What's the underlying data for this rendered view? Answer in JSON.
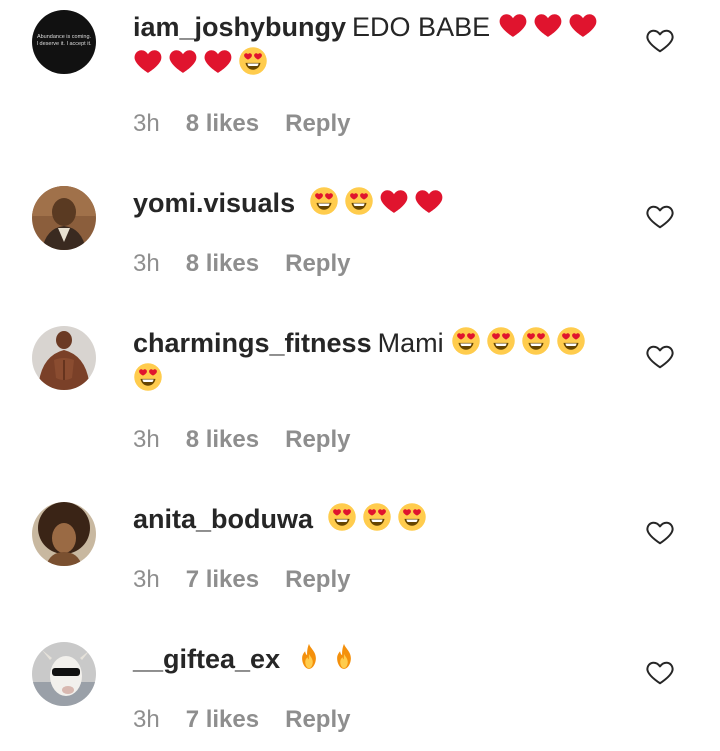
{
  "comments": [
    {
      "username": "iam_joshybungy",
      "text": "EDO BABE",
      "emojis": [
        "red-heart",
        "red-heart",
        "red-heart",
        "red-heart",
        "red-heart",
        "red-heart",
        "heart-eyes"
      ],
      "time": "3h",
      "likes": "8 likes",
      "reply": "Reply",
      "avatar_text": [
        "Abundance is coming.",
        "I deserve it. I accept it."
      ]
    },
    {
      "username": "yomi.visuals",
      "text": "",
      "emojis": [
        "heart-eyes",
        "heart-eyes",
        "red-heart",
        "red-heart"
      ],
      "time": "3h",
      "likes": "8 likes",
      "reply": "Reply"
    },
    {
      "username": "charmings_fitness",
      "text": "Mami",
      "emojis": [
        "heart-eyes",
        "heart-eyes",
        "heart-eyes",
        "heart-eyes",
        "heart-eyes"
      ],
      "time": "3h",
      "likes": "8 likes",
      "reply": "Reply"
    },
    {
      "username": "anita_boduwa",
      "text": "",
      "emojis": [
        "heart-eyes",
        "heart-eyes",
        "heart-eyes"
      ],
      "time": "3h",
      "likes": "7 likes",
      "reply": "Reply"
    },
    {
      "username": "__giftea_ex",
      "text": "",
      "emojis": [
        "fire",
        "fire"
      ],
      "time": "3h",
      "likes": "7 likes",
      "reply": "Reply"
    }
  ],
  "icons": {
    "like": "heart-outline-icon"
  },
  "colors": {
    "text": "#262626",
    "secondary": "#8e8e8e",
    "heart": "#e0142e"
  }
}
